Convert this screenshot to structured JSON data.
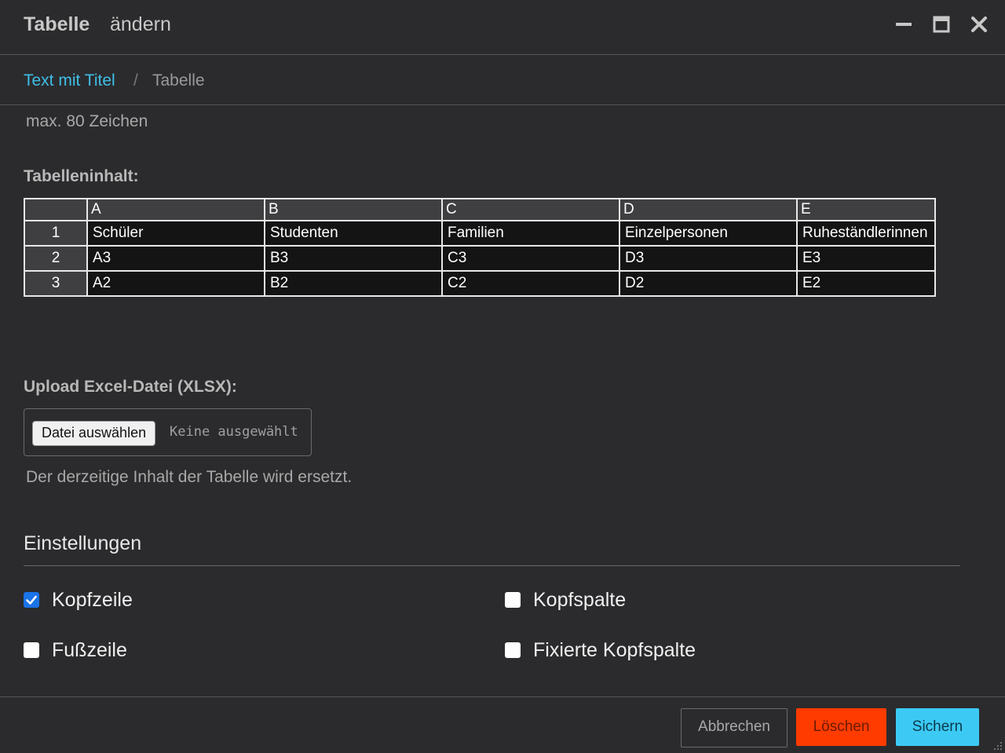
{
  "window": {
    "title_bold": "Tabelle",
    "title_rest": "ändern",
    "controls": [
      "minimize-icon",
      "maximize-icon",
      "close-icon"
    ]
  },
  "breadcrumb": {
    "link": "Text mit Titel",
    "separator": "/",
    "current": "Tabelle"
  },
  "field_hint": "max. 80 Zeichen",
  "table_section": {
    "label": "Tabelleninhalt:",
    "column_headers": [
      "A",
      "B",
      "C",
      "D",
      "E"
    ],
    "rows": [
      {
        "num": "1",
        "cells": [
          "Schüler",
          "Studenten",
          "Familien",
          "Einzelpersonen",
          "Ruheständlerinnen"
        ]
      },
      {
        "num": "2",
        "cells": [
          "A3",
          "B3",
          "C3",
          "D3",
          "E3"
        ]
      },
      {
        "num": "3",
        "cells": [
          "A2",
          "B2",
          "C2",
          "D2",
          "E2"
        ]
      }
    ]
  },
  "upload": {
    "label": "Upload Excel-Datei (XLSX):",
    "button": "Datei auswählen",
    "no_file": "Keine ausgewählt",
    "hint": "Der derzeitige Inhalt der Tabelle wird ersetzt."
  },
  "settings": {
    "title": "Einstellungen",
    "options": {
      "kopfzeile": {
        "label": "Kopfzeile",
        "checked": true
      },
      "kopfspalte": {
        "label": "Kopfspalte",
        "checked": false
      },
      "fusszeile": {
        "label": "Fußzeile",
        "checked": false
      },
      "fixierte_kopfspalte": {
        "label": "Fixierte Kopfspalte",
        "checked": false
      }
    }
  },
  "footer": {
    "cancel": "Abbrechen",
    "delete": "Löschen",
    "save": "Sichern"
  },
  "colors": {
    "background": "#2b2b2d",
    "link": "#3fbfe8",
    "delete": "#ff3b00",
    "save": "#3ccaf5",
    "checkbox_checked": "#1a73e8"
  }
}
